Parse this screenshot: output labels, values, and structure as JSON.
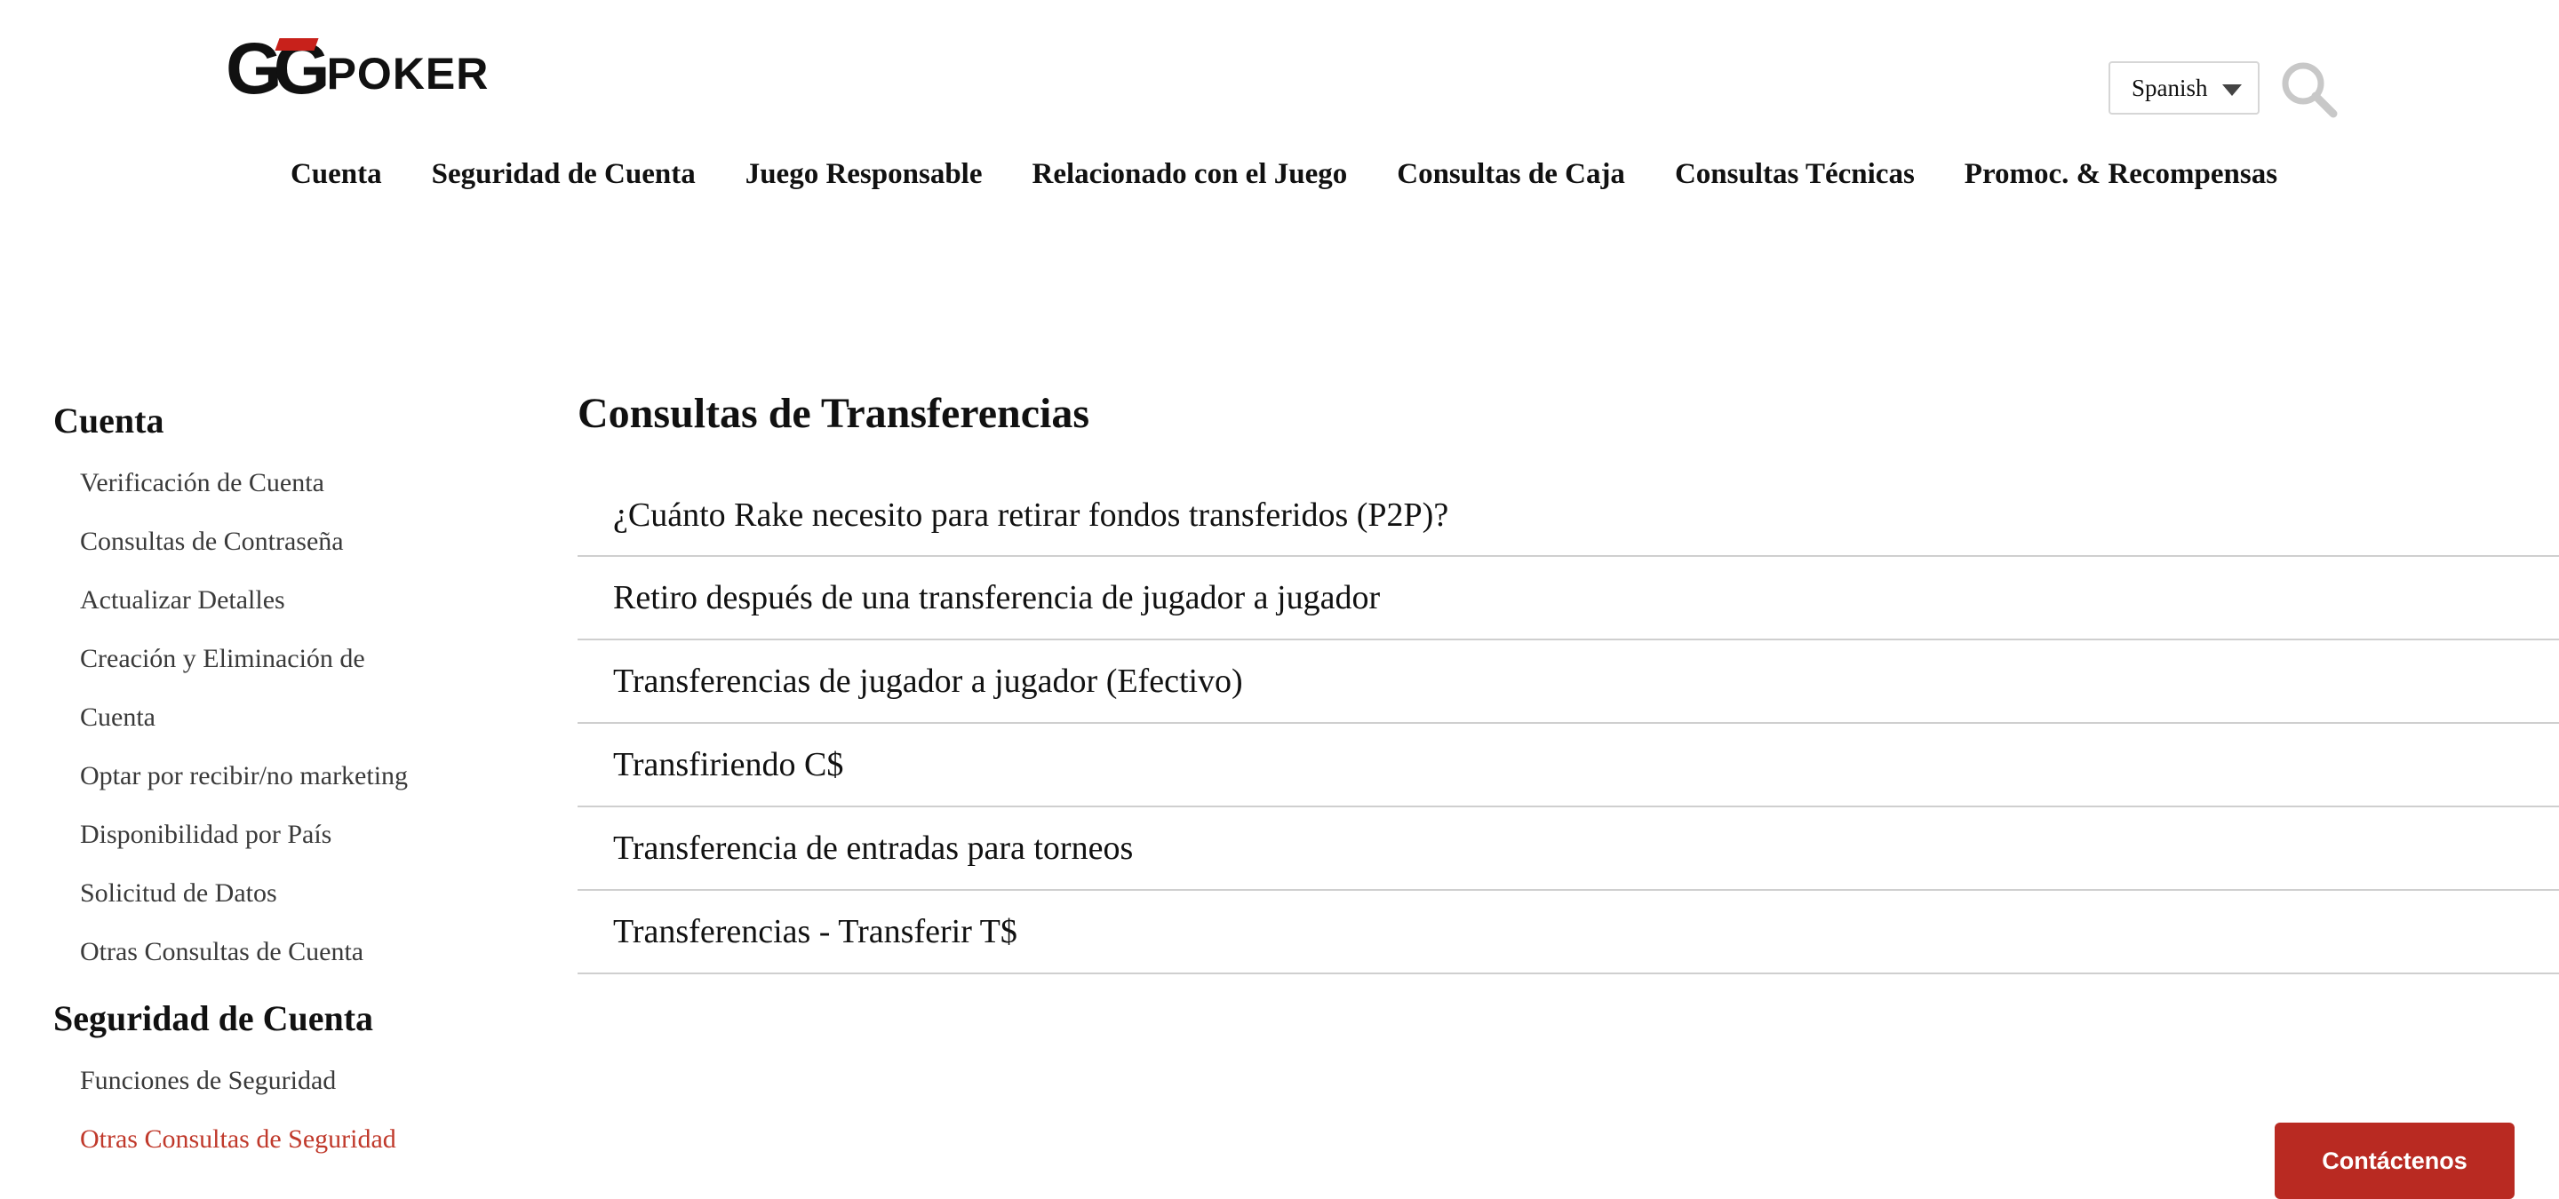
{
  "header": {
    "logo": {
      "text_gg": "GG",
      "text_poker": "POKER"
    },
    "language": {
      "selected": "Spanish"
    },
    "search_icon": "search-icon"
  },
  "nav": {
    "items": [
      "Cuenta",
      "Seguridad de Cuenta",
      "Juego Responsable",
      "Relacionado con el Juego",
      "Consultas de Caja",
      "Consultas Técnicas",
      "Promoc. & Recompensas"
    ]
  },
  "sidebar": {
    "sections": [
      {
        "title": "Cuenta",
        "items": [
          "Verificación de Cuenta",
          "Consultas de Contraseña",
          "Actualizar Detalles",
          "Creación y Eliminación de",
          "Cuenta",
          "Optar por recibir/no marketing",
          "Disponibilidad por País",
          "Solicitud de Datos",
          "Otras Consultas de Cuenta"
        ]
      },
      {
        "title": "Seguridad de Cuenta",
        "items": [
          "Funciones de Seguridad",
          "Otras Consultas de Seguridad"
        ]
      }
    ]
  },
  "main": {
    "title": "Consultas de Transferencias",
    "articles": [
      "¿Cuánto Rake necesito para retirar fondos transferidos (P2P)?",
      "Retiro después de una transferencia de jugador a jugador",
      "Transferencias de jugador a jugador (Efectivo)",
      "Transfiriendo C$",
      "Transferencia de entradas para torneos",
      "Transferencias - Transferir T$"
    ]
  },
  "contact": {
    "label": "Contáctenos"
  },
  "colors": {
    "accent": "#c0392b",
    "button": "#b92a22",
    "divider": "#cfcfcf"
  }
}
